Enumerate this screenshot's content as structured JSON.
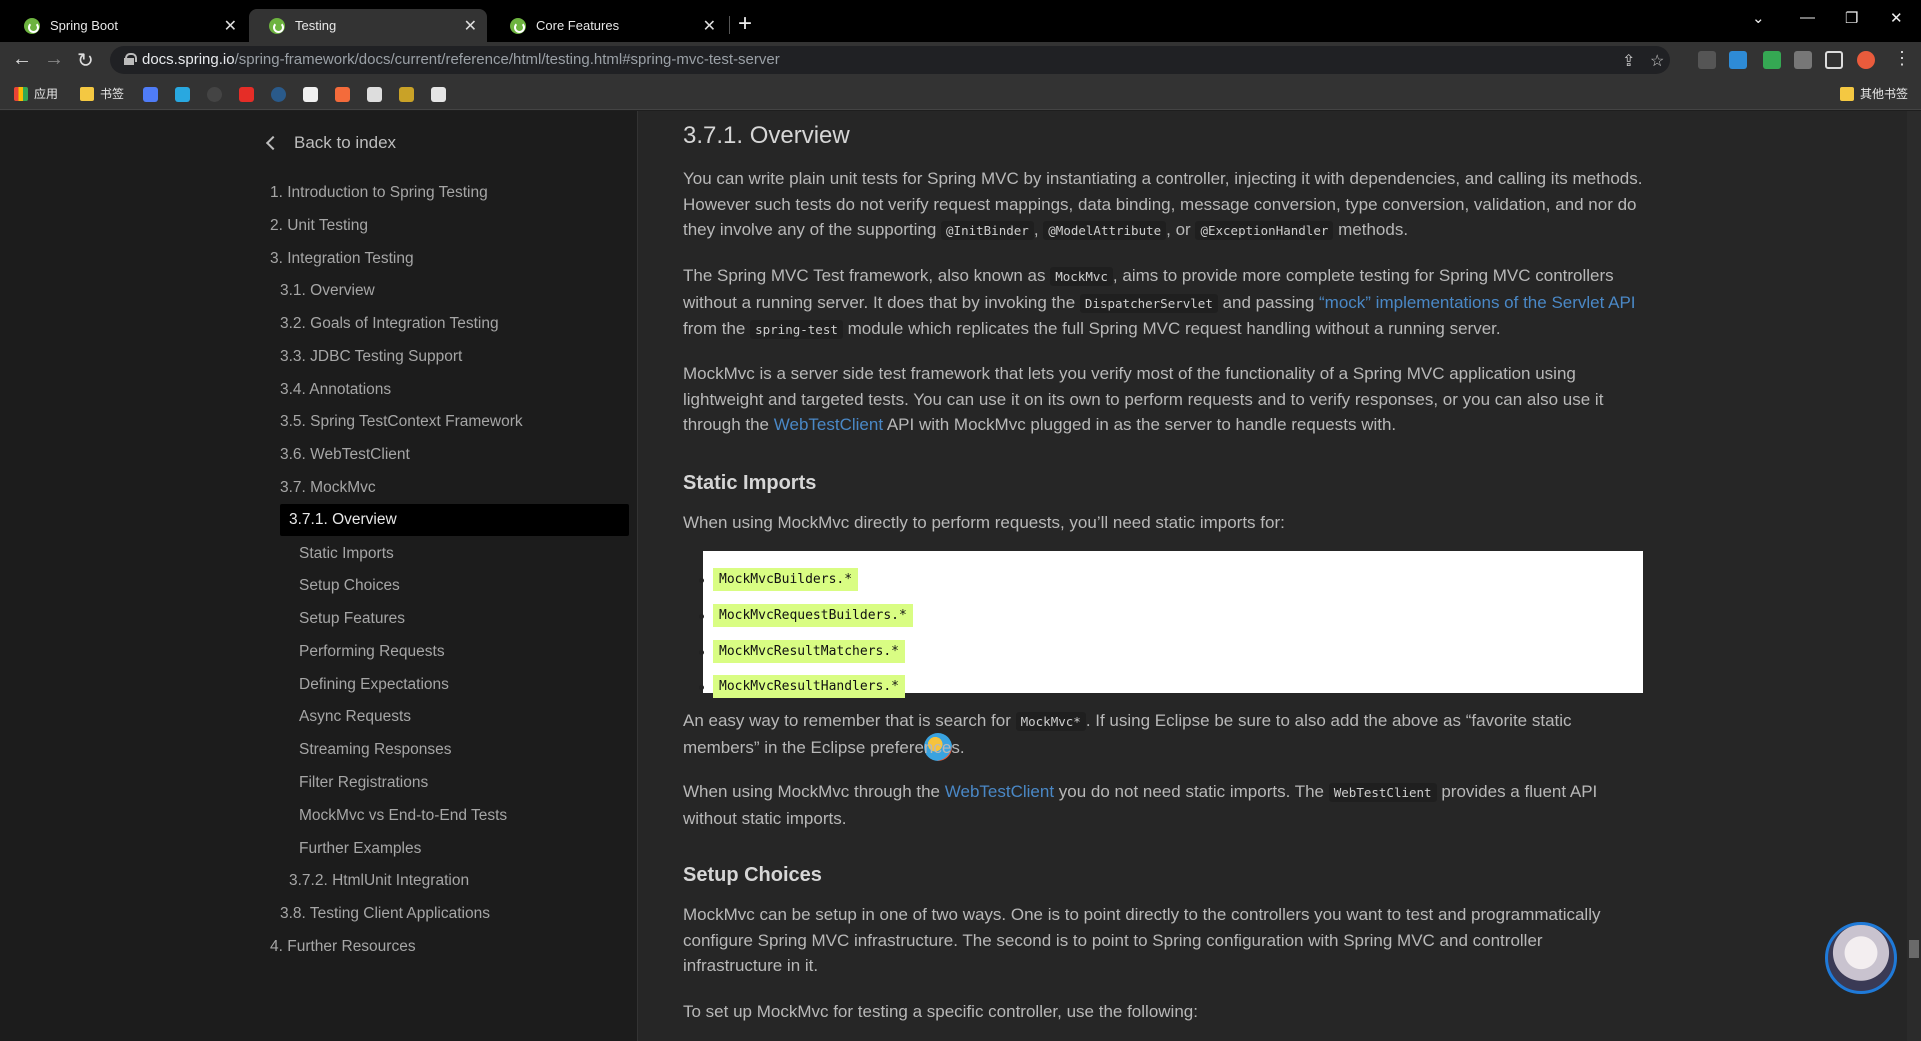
{
  "browser": {
    "tabs": [
      {
        "title": "Spring Boot"
      },
      {
        "title": "Testing"
      },
      {
        "title": "Core Features"
      }
    ],
    "url_domain": "docs.spring.io",
    "url_path": "/spring-framework/docs/current/reference/html/testing.html#spring-mvc-test-server",
    "bookmarks": [
      {
        "label": "应用"
      },
      {
        "label": "书签"
      },
      {
        "label": "其他书签"
      }
    ]
  },
  "sidebar": {
    "back_label": "Back to index",
    "items": [
      {
        "label": "1. Introduction to Spring Testing"
      },
      {
        "label": "2. Unit Testing"
      },
      {
        "label": "3. Integration Testing"
      },
      {
        "label": "3.1. Overview"
      },
      {
        "label": "3.2. Goals of Integration Testing"
      },
      {
        "label": "3.3. JDBC Testing Support"
      },
      {
        "label": "3.4. Annotations"
      },
      {
        "label": "3.5. Spring TestContext Framework"
      },
      {
        "label": "3.6. WebTestClient"
      },
      {
        "label": "3.7. MockMvc"
      },
      {
        "label": "3.7.1. Overview"
      },
      {
        "label": "Static Imports"
      },
      {
        "label": "Setup Choices"
      },
      {
        "label": "Setup Features"
      },
      {
        "label": "Performing Requests"
      },
      {
        "label": "Defining Expectations"
      },
      {
        "label": "Async Requests"
      },
      {
        "label": "Streaming Responses"
      },
      {
        "label": "Filter Registrations"
      },
      {
        "label": "MockMvc vs End-to-End Tests"
      },
      {
        "label": "Further Examples"
      },
      {
        "label": "3.7.2. HtmlUnit Integration"
      },
      {
        "label": "3.8. Testing Client Applications"
      },
      {
        "label": "4. Further Resources"
      }
    ]
  },
  "main": {
    "overview_title": "3.7.1. Overview",
    "p1_a": "You can write plain unit tests for Spring MVC by instantiating a controller, injecting it with dependencies, and calling its methods. However such tests do not verify request mappings, data binding, message conversion, type conversion, validation, and nor do they involve any of the supporting",
    "p1_code1": "@InitBinder",
    "p1_code2": "@ModelAttribute",
    "p1_or": ", or",
    "p1_code3": "@ExceptionHandler",
    "p1_end": "methods.",
    "p2_a": "The Spring MVC Test framework, also known as",
    "p2_code1": "MockMvc",
    "p2_b": ", aims to provide more complete testing for Spring MVC controllers without a running server. It does that by invoking the",
    "p2_code2": "DispatcherServlet",
    "p2_c": "and passing",
    "p2_link": "“mock” implementations of the Servlet API",
    "p2_d": "from the",
    "p2_code3": "spring-test",
    "p2_e": "module which replicates the full Spring MVC request handling without a running server.",
    "p3_a": "MockMvc is a server side test framework that lets you verify most of the functionality of a Spring MVC application using lightweight and targeted tests. You can use it on its own to perform requests and to verify responses, or you can also use it through the",
    "p3_link": "WebTestClient",
    "p3_b": "API with MockMvc plugged in as the server to handle requests with.",
    "static_imports_title": "Static Imports",
    "p4": "When using MockMvc directly to perform requests, you’ll need static imports for:",
    "imports": [
      "MockMvcBuilders.*",
      "MockMvcRequestBuilders.*",
      "MockMvcResultMatchers.*",
      "MockMvcResultHandlers.*"
    ],
    "p5_a": "An easy way to remember that is search for",
    "p5_code": "MockMvc*",
    "p5_b": ". If using Eclipse be sure to also add the above as “favorite static members” in the Eclipse preferences.",
    "p6_a": "When using MockMvc through the",
    "p6_link": "WebTestClient",
    "p6_b": "you do not need static imports. The",
    "p6_code": "WebTestClient",
    "p6_c": "provides a fluent API without static imports.",
    "setup_choices_title": "Setup Choices",
    "p7": "MockMvc can be setup in one of two ways. One is to point directly to the controllers you want to test and programmatically configure Spring MVC infrastructure. The second is to point to Spring configuration with Spring MVC and controller infrastructure in it.",
    "p8": "To set up MockMvc for testing a specific controller, use the following:"
  },
  "colors": {
    "link": "#4a88c6",
    "highlight": "#d9fd83",
    "spring_green": "#6db33f"
  }
}
